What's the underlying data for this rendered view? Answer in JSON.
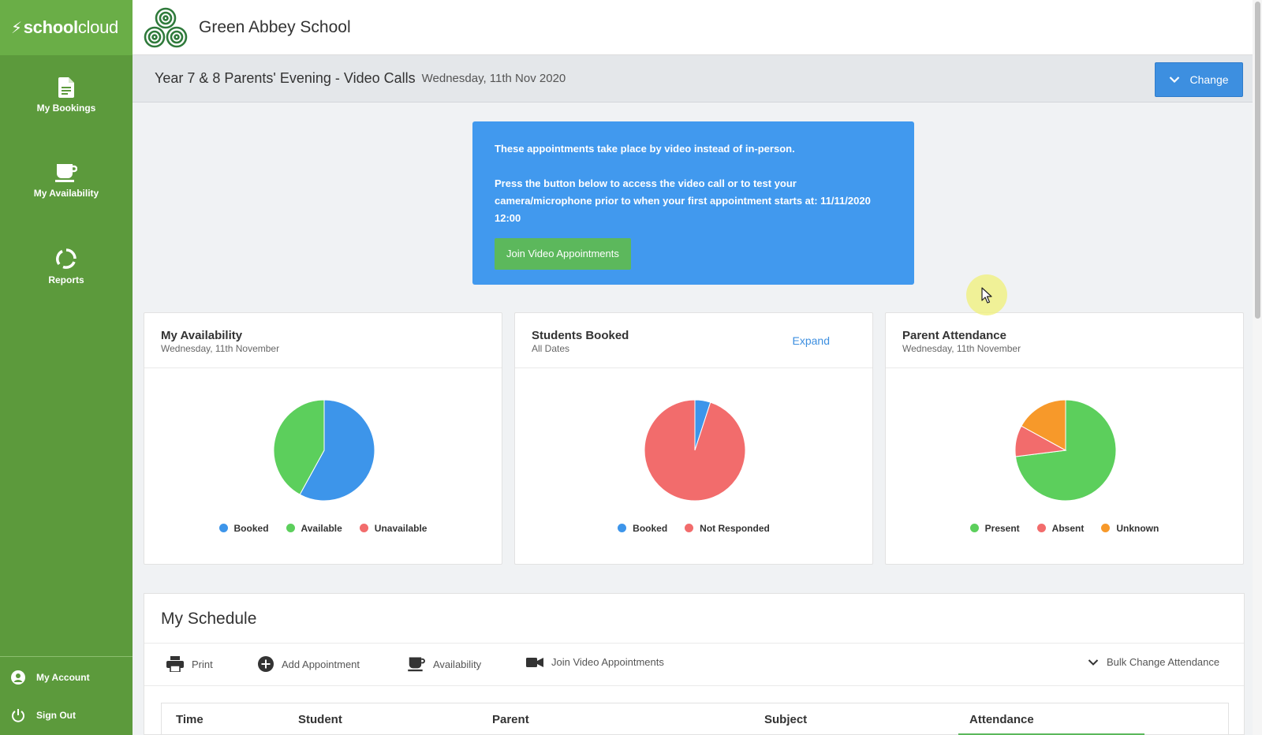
{
  "brand": {
    "part1": "school",
    "part2": "cloud"
  },
  "sidebar": {
    "items": [
      {
        "label": "My Bookings",
        "icon": "document-icon"
      },
      {
        "label": "My Availability",
        "icon": "coffee-cup-icon"
      },
      {
        "label": "Reports",
        "icon": "circle-refresh-icon"
      }
    ],
    "account": "My Account",
    "signout": "Sign Out"
  },
  "header": {
    "school_name": "Green Abbey School"
  },
  "event": {
    "title": "Year 7 & 8 Parents' Evening - Video Calls",
    "date": "Wednesday, 11th Nov 2020",
    "change_label": "Change"
  },
  "info": {
    "line1": "These appointments take place by video instead of in-person.",
    "line2": "Press the button below to access the video call or to test your camera/microphone prior to when your first appointment starts at: 11/11/2020 12:00",
    "button": "Join Video Appointments"
  },
  "cards": {
    "availability": {
      "title": "My Availability",
      "subtitle": "Wednesday, 11th November",
      "legend": [
        "Booked",
        "Available",
        "Unavailable"
      ]
    },
    "students": {
      "title": "Students Booked",
      "subtitle": "All Dates",
      "expand": "Expand",
      "legend": [
        "Booked",
        "Not Responded"
      ]
    },
    "attendance": {
      "title": "Parent Attendance",
      "subtitle": "Wednesday, 11th November",
      "legend": [
        "Present",
        "Absent",
        "Unknown"
      ]
    }
  },
  "colors": {
    "green": "#5ccf5c",
    "blue": "#3d95ea",
    "red": "#f26c6c",
    "orange": "#f7992a"
  },
  "chart_data": [
    {
      "type": "pie",
      "title": "My Availability",
      "categories": [
        "Booked",
        "Available",
        "Unavailable"
      ],
      "values": [
        58,
        42,
        0
      ],
      "colors": [
        "#3d95ea",
        "#5ccf5c",
        "#f26c6c"
      ]
    },
    {
      "type": "pie",
      "title": "Students Booked",
      "categories": [
        "Booked",
        "Not Responded"
      ],
      "values": [
        5,
        95
      ],
      "colors": [
        "#3d95ea",
        "#f26c6c"
      ]
    },
    {
      "type": "pie",
      "title": "Parent Attendance",
      "categories": [
        "Present",
        "Absent",
        "Unknown"
      ],
      "values": [
        73,
        10,
        17
      ],
      "colors": [
        "#5ccf5c",
        "#f26c6c",
        "#f7992a"
      ]
    }
  ],
  "schedule": {
    "title": "My Schedule",
    "toolbar": {
      "print": "Print",
      "add": "Add Appointment",
      "availability": "Availability",
      "join": "Join Video Appointments",
      "bulk": "Bulk Change Attendance"
    },
    "columns": [
      "Time",
      "Student",
      "Parent",
      "Subject",
      "Attendance"
    ]
  }
}
